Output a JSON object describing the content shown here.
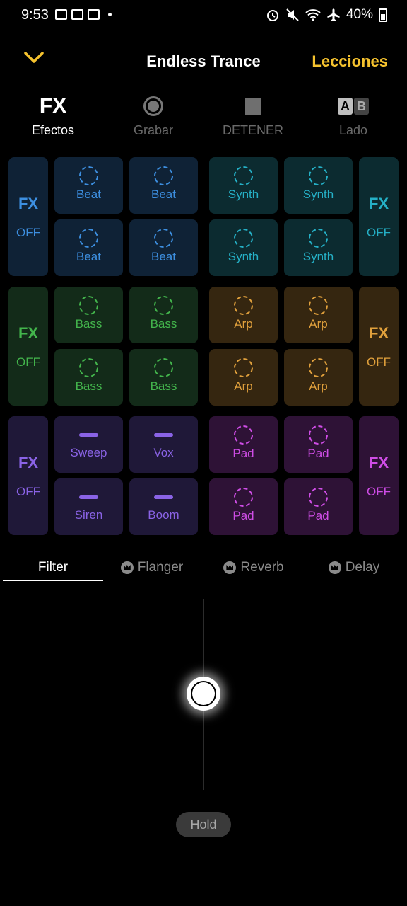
{
  "status_bar": {
    "time": "9:53",
    "battery": "40%"
  },
  "header": {
    "title": "Endless Trance",
    "lessons": "Lecciones"
  },
  "toolbar": {
    "effects": {
      "icon": "FX",
      "label": "Efectos"
    },
    "record": {
      "label": "Grabar"
    },
    "stop": {
      "label": "DETENER"
    },
    "side": {
      "a": "A",
      "b": "B",
      "label": "Lado"
    }
  },
  "pads": {
    "fx_label": "FX",
    "off_label": "OFF",
    "beat": "Beat",
    "synth": "Synth",
    "bass": "Bass",
    "arp": "Arp",
    "sweep": "Sweep",
    "vox": "Vox",
    "siren": "Siren",
    "boom": "Boom",
    "pad": "Pad"
  },
  "effect_tabs": {
    "filter": "Filter",
    "flanger": "Flanger",
    "reverb": "Reverb",
    "delay": "Delay"
  },
  "hold_label": "Hold",
  "colors": {
    "accent": "#f5c22e",
    "beat": "#3d8fe0",
    "synth": "#25b0c6",
    "bass": "#43b54c",
    "arp": "#e0a03c",
    "vocal": "#8a63e6",
    "pad": "#cf4de6"
  }
}
